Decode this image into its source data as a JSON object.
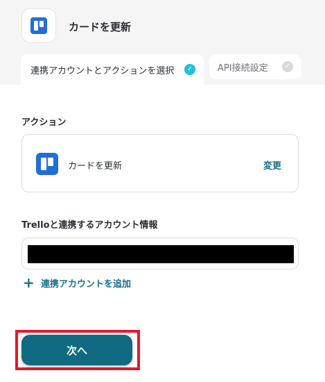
{
  "header": {
    "title": "カードを更新",
    "logo_icon": "trello-icon",
    "brand_color": "#1f6fd6"
  },
  "tabs": [
    {
      "label": "連携アカウントとアクションを選択",
      "state": "active",
      "status_icon": "check-icon"
    },
    {
      "label": "API接続設定",
      "state": "inactive",
      "status_icon": "check-icon"
    }
  ],
  "action_section": {
    "label": "アクション",
    "action_name": "カードを更新",
    "change_label": "変更",
    "action_icon": "trello-icon"
  },
  "account_section": {
    "label": "Trelloと連携するアカウント情報",
    "add_account_label": "連携アカウントを追加",
    "add_icon": "plus-icon"
  },
  "footer": {
    "next_label": "次へ",
    "accent_color": "#0f6a82",
    "highlight_color": "#e01a2c"
  }
}
